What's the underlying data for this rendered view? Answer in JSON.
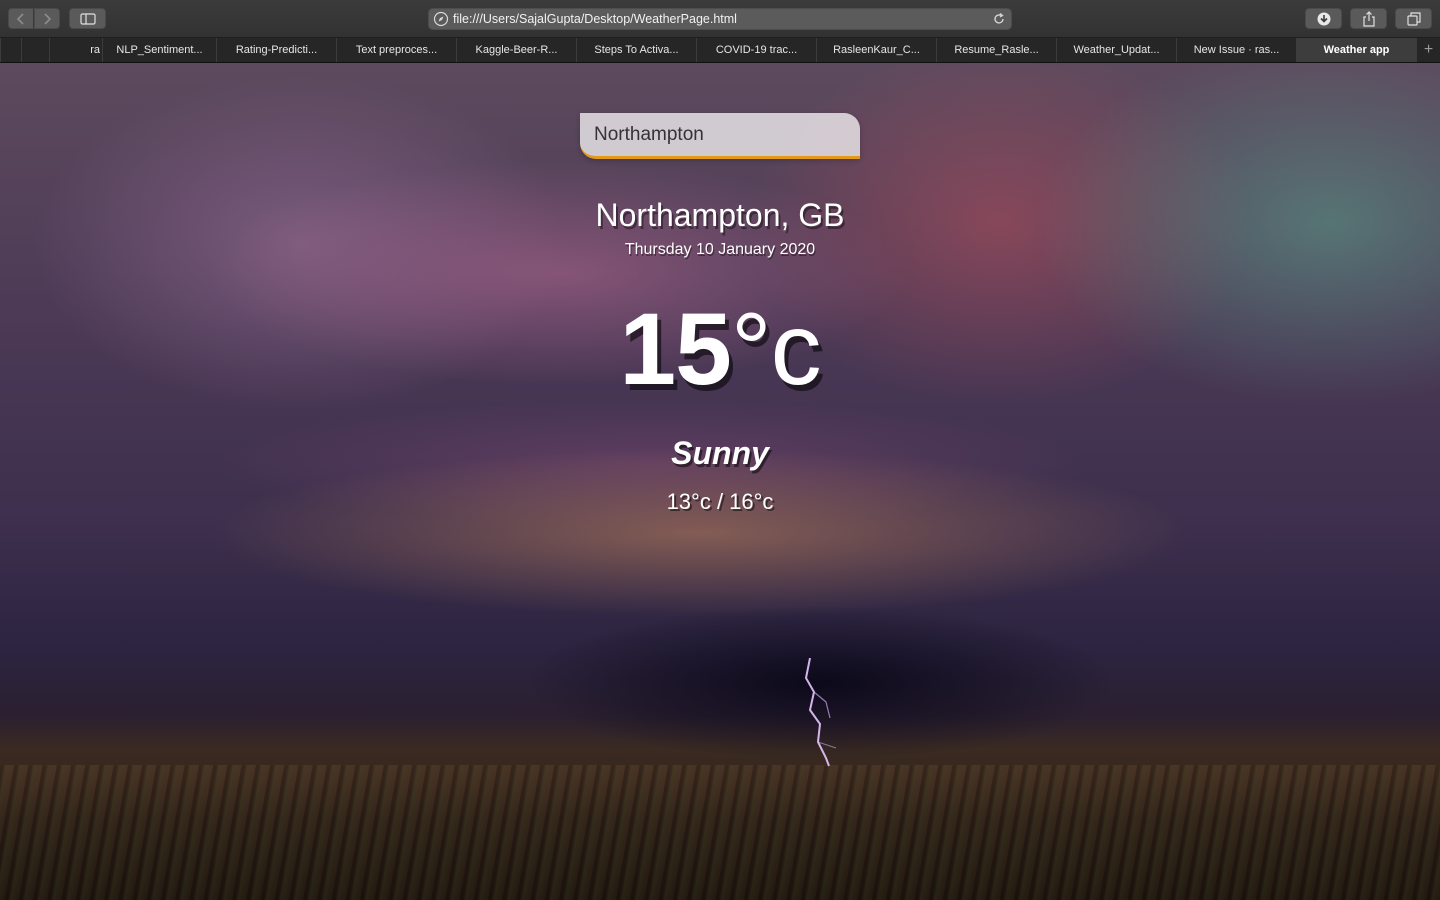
{
  "browser": {
    "url": "file:///Users/SajalGupta/Desktop/WeatherPage.html",
    "tabs": [
      {
        "label": ""
      },
      {
        "label": ""
      },
      {
        "label": "ra"
      },
      {
        "label": "NLP_Sentiment..."
      },
      {
        "label": "Rating-Predicti..."
      },
      {
        "label": "Text preproces..."
      },
      {
        "label": "Kaggle-Beer-R..."
      },
      {
        "label": "Steps To Activa..."
      },
      {
        "label": "COVID-19 trac..."
      },
      {
        "label": "RasleenKaur_C..."
      },
      {
        "label": "Resume_Rasle..."
      },
      {
        "label": "Weather_Updat..."
      },
      {
        "label": "New Issue · ras..."
      },
      {
        "label": "Weather app"
      }
    ],
    "active_tab": "Weather app",
    "new_tab_symbol": "+"
  },
  "app": {
    "search_value": "Northampton",
    "location": "Northampton, GB",
    "date": "Thursday 10 January 2020",
    "temperature": "15",
    "temperature_unit": "°c",
    "condition": "Sunny",
    "hi_low": "13°c / 16°c"
  },
  "colors": {
    "search_underline": "#e39a1b",
    "text": "#ffffff"
  }
}
